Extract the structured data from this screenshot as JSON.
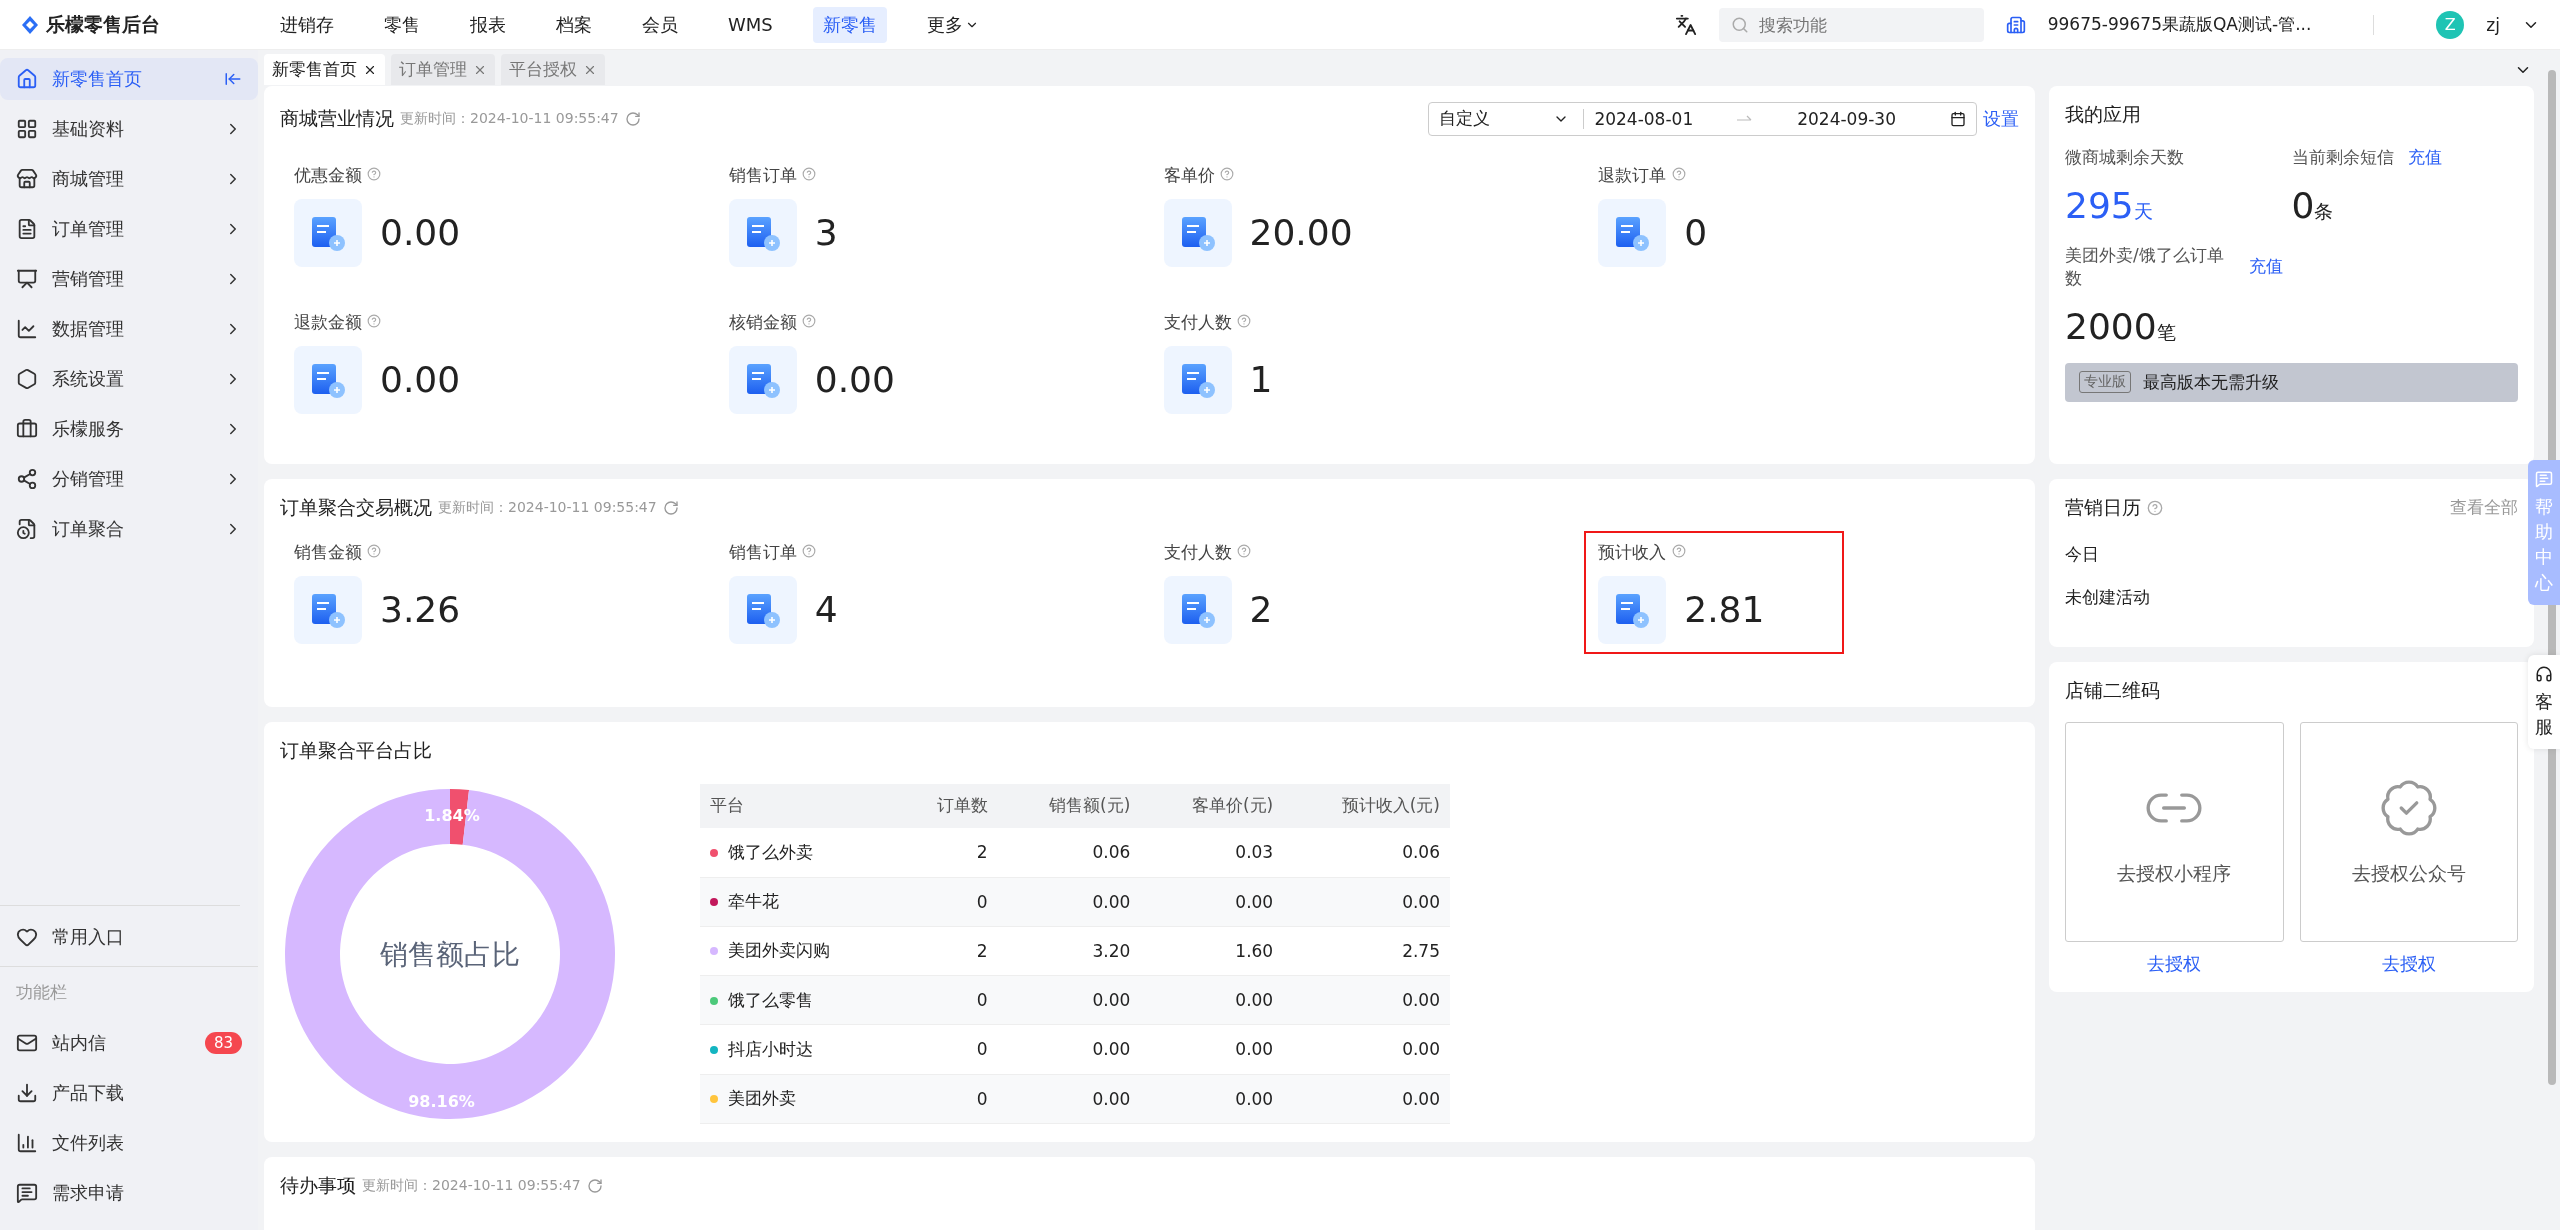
{
  "app": {
    "logo": "乐檬零售后台"
  },
  "top_nav": [
    {
      "label": "进销存",
      "selected": false
    },
    {
      "label": "零售",
      "selected": false
    },
    {
      "label": "报表",
      "selected": false
    },
    {
      "label": "档案",
      "selected": false
    },
    {
      "label": "会员",
      "selected": false
    },
    {
      "label": "WMS",
      "selected": false
    },
    {
      "label": "新零售",
      "selected": true
    },
    {
      "label": "更多",
      "selected": false,
      "dropdown": true
    }
  ],
  "header_right": {
    "search": {
      "placeholder": "搜索功能"
    },
    "store": "99675-99675果蔬版QA测试-管...",
    "user": {
      "avatar": "Z",
      "name": "zj"
    }
  },
  "sidebar": {
    "items": [
      {
        "label": "新零售首页",
        "selected": true
      },
      {
        "label": "基础资料",
        "selected": false
      },
      {
        "label": "商城管理",
        "selected": false
      },
      {
        "label": "订单管理",
        "selected": false
      },
      {
        "label": "营销管理",
        "selected": false
      },
      {
        "label": "数据管理",
        "selected": false
      },
      {
        "label": "系统设置",
        "selected": false
      },
      {
        "label": "乐檬服务",
        "selected": false
      },
      {
        "label": "分销管理",
        "selected": false
      },
      {
        "label": "订单聚合",
        "selected": false
      }
    ],
    "favorites": "常用入口",
    "section_title": "功能栏",
    "tools": [
      {
        "label": "站内信",
        "badge": "83"
      },
      {
        "label": "产品下载"
      },
      {
        "label": "文件列表"
      },
      {
        "label": "需求申请"
      }
    ]
  },
  "tabs": [
    {
      "label": "新零售首页",
      "selected": true
    },
    {
      "label": "订单管理",
      "selected": false
    },
    {
      "label": "平台授权",
      "selected": false
    }
  ],
  "store_overview": {
    "title": "商城营业情况",
    "updated": "更新时间：2024-10-11 09:55:47",
    "range": {
      "mode": "自定义",
      "start": "2024-08-01",
      "end": "2024-09-30"
    },
    "settings_link": "设置",
    "stats": [
      {
        "label": "优惠金额",
        "value": "0.00"
      },
      {
        "label": "销售订单",
        "value": "3"
      },
      {
        "label": "客单价",
        "value": "20.00"
      },
      {
        "label": "退款订单",
        "value": "0"
      },
      {
        "label": "退款金额",
        "value": "0.00"
      },
      {
        "label": "核销金额",
        "value": "0.00"
      },
      {
        "label": "支付人数",
        "value": "1"
      }
    ]
  },
  "aggregation_overview": {
    "title": "订单聚合交易概况",
    "updated": "更新时间：2024-10-11 09:55:47",
    "stats": [
      {
        "label": "销售金额",
        "value": "3.26",
        "highlighted": false
      },
      {
        "label": "销售订单",
        "value": "4",
        "highlighted": false
      },
      {
        "label": "支付人数",
        "value": "2",
        "highlighted": false
      },
      {
        "label": "预计收入",
        "value": "2.81",
        "highlighted": true
      }
    ]
  },
  "platform_share": {
    "title": "订单聚合平台占比",
    "chart_data": {
      "type": "donut",
      "title": "销售额占比",
      "values": [
        1.84,
        98.16
      ],
      "value_labels": [
        "1.84%",
        "98.16%"
      ]
    },
    "table": {
      "columns": [
        "平台",
        "订单数",
        "销售额(元)",
        "客单价(元)",
        "预计收入(元)"
      ],
      "rows": [
        {
          "color": "#f0506e",
          "cells": [
            "饿了么外卖",
            "2",
            "0.06",
            "0.03",
            "0.06"
          ]
        },
        {
          "color": "#c2185b",
          "cells": [
            "牵牛花",
            "0",
            "0.00",
            "0.00",
            "0.00"
          ]
        },
        {
          "color": "#d6b8ff",
          "cells": [
            "美团外卖闪购",
            "2",
            "3.20",
            "1.60",
            "2.75"
          ]
        },
        {
          "color": "#4cc97a",
          "cells": [
            "饿了么零售",
            "0",
            "0.00",
            "0.00",
            "0.00"
          ]
        },
        {
          "color": "#13b5c1",
          "cells": [
            "抖店小时达",
            "0",
            "0.00",
            "0.00",
            "0.00"
          ]
        },
        {
          "color": "#ffc53d",
          "cells": [
            "美团外卖",
            "0",
            "0.00",
            "0.00",
            "0.00"
          ]
        }
      ]
    }
  },
  "todo": {
    "title": "待办事项",
    "updated": "更新时间：2024-10-11 09:55:47"
  },
  "my_apps": {
    "title": "我的应用",
    "items": [
      {
        "label": "微商城剩余天数",
        "value": "295",
        "unit": "天",
        "highlight": true
      },
      {
        "label": "当前剩余短信",
        "link": "充值",
        "value": "0",
        "unit": "条",
        "highlight": false
      },
      {
        "label": "美团外卖/饿了么订单数",
        "link": "充值",
        "value": "2000",
        "unit": "笔",
        "highlight": false
      }
    ],
    "edition": {
      "tag": "专业版",
      "text": "最高版本无需升级"
    }
  },
  "marketing_calendar": {
    "title": "营销日历",
    "link": "查看全部",
    "day": "今日",
    "empty": "未创建活动"
  },
  "store_qr": {
    "title": "店铺二维码",
    "cards": [
      {
        "label": "去授权小程序",
        "link": "去授权"
      },
      {
        "label": "去授权公众号",
        "link": "去授权"
      }
    ]
  },
  "float_buttons": {
    "help": "帮助中心",
    "service": "客服"
  }
}
